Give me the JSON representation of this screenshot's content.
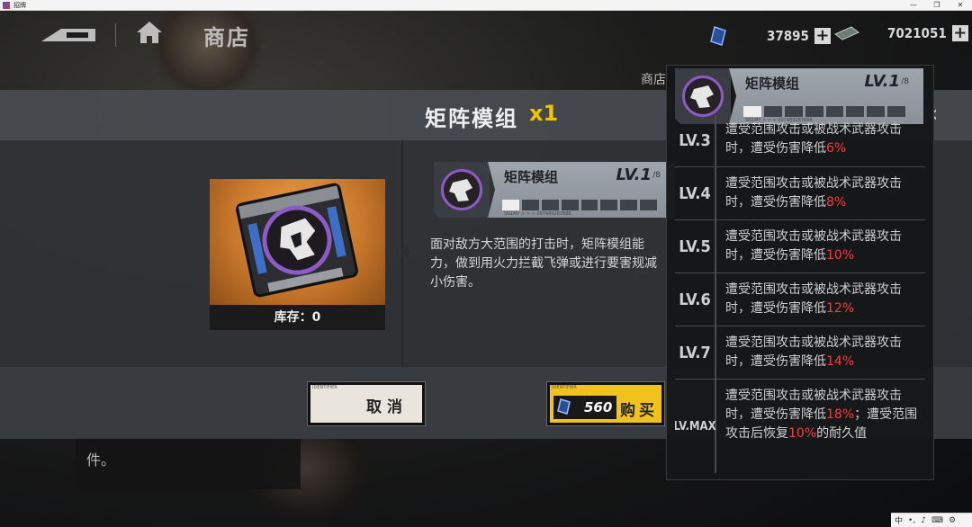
{
  "window": {
    "title": "招牌",
    "controls": [
      "—",
      "❐",
      "✕"
    ]
  },
  "nav": {
    "title": "商店",
    "shop_tab": "商店",
    "currencies": [
      {
        "icon": "crystal-icon",
        "amount": "37895"
      },
      {
        "icon": "card-icon",
        "amount": "7021051"
      }
    ],
    "plus": "+"
  },
  "dialog": {
    "title": "矩阵模组",
    "quantity": "x1",
    "close": "‹",
    "stock_label": "库存：0",
    "module": {
      "name": "矩阵模组",
      "level": "LV.1",
      "level_max": "/8",
      "filled_segments": 1,
      "total_segments": 8,
      "serial": "SN1MY > > > 007489287888"
    },
    "description": "面对敌方大范围的打击时，矩阵模组能力，做到用火力拦截飞弹或进行要害规减小伤害。",
    "buttons": {
      "cancel": "取消",
      "buy_price": "560",
      "buy": "购买",
      "btn_tag": "IDENTIFIER"
    },
    "under_text": "件。"
  },
  "tooltip": {
    "module": {
      "name": "矩阵模组",
      "level": "LV.1",
      "level_max": "/8",
      "serial": "SN1MY > > > 007489287888"
    },
    "levels": [
      {
        "lv": "LV.3",
        "text": "遭受范围攻击或被战术武器攻击时，遭受伤害降低",
        "value": "6%"
      },
      {
        "lv": "LV.4",
        "text": "遭受范围攻击或被战术武器攻击时，遭受伤害降低",
        "value": "8%"
      },
      {
        "lv": "LV.5",
        "text": "遭受范围攻击或被战术武器攻击时，遭受伤害降低",
        "value": "10%"
      },
      {
        "lv": "LV.6",
        "text": "遭受范围攻击或被战术武器攻击时，遭受伤害降低",
        "value": "12%"
      },
      {
        "lv": "LV.7",
        "text": "遭受范围攻击或被战术武器攻击时，遭受伤害降低",
        "value": "14%"
      },
      {
        "lv": "LV.MAX",
        "text": "遭受范围攻击或被战术武器攻击时，遭受伤害降低",
        "value": "18%",
        "text2": "；遭受范围攻击后恢复",
        "value2": "10%",
        "text3": "的耐久值"
      }
    ]
  },
  "tray": [
    "中",
    "•,",
    "♪",
    "⌨",
    "⚙"
  ],
  "colors": {
    "accent_yellow": "#f0c21b",
    "highlight_red": "#ff3a3a",
    "emblem_purple": "#8d5bc4"
  }
}
